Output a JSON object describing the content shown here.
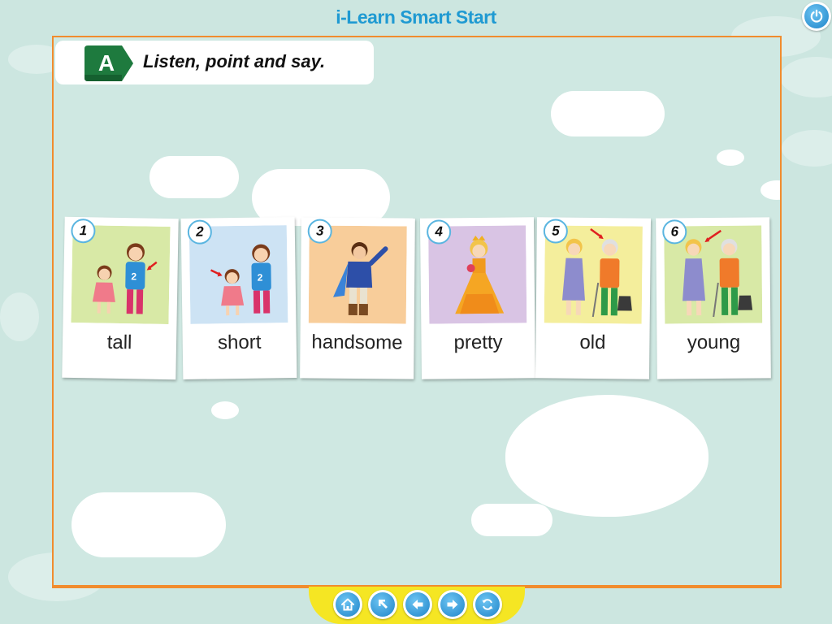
{
  "app": {
    "title": "i-Learn Smart Start"
  },
  "activity": {
    "badge": "A",
    "instruction": "Listen, point and say."
  },
  "cards": [
    {
      "number": "1",
      "word": "tall"
    },
    {
      "number": "2",
      "word": "short"
    },
    {
      "number": "3",
      "word": "handsome"
    },
    {
      "number": "4",
      "word": "pretty"
    },
    {
      "number": "5",
      "word": "old"
    },
    {
      "number": "6",
      "word": "young"
    }
  ],
  "nav": {
    "buttons": [
      "home-icon",
      "pointer-arrow-icon",
      "back-arrow-icon",
      "forward-arrow-icon",
      "refresh-icon"
    ]
  },
  "colors": {
    "title": "#1f9ad2",
    "stage_border": "#f18c2e",
    "badge": "#1e7a3e",
    "nav_bar": "#f5e623",
    "button_blue": "#1f84c9"
  }
}
